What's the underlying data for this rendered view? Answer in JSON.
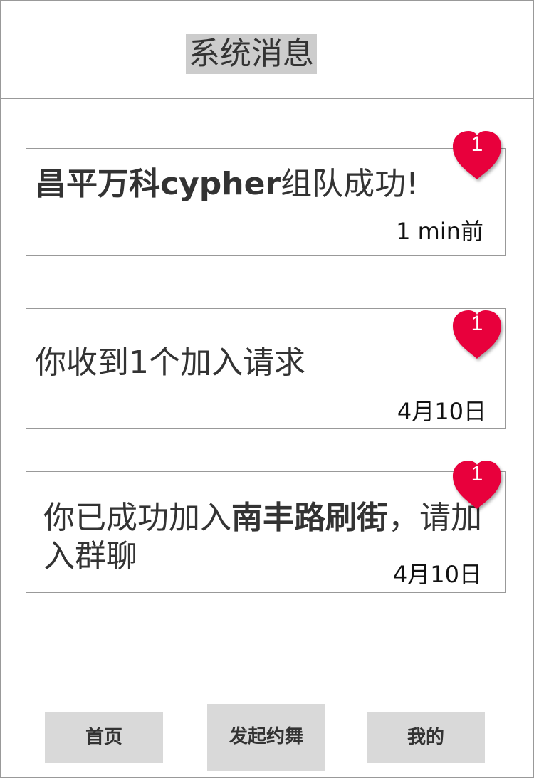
{
  "header": {
    "title": "系统消息"
  },
  "messages": [
    {
      "bold_part": "昌平万科cypher",
      "normal_part": "组队成功!",
      "time": "1 min前",
      "badge": "1"
    },
    {
      "text": "你收到1个加入请求",
      "time": "4月10日",
      "badge": "1"
    },
    {
      "prefix": "你已成功加入",
      "bold_part": "南丰路刷街",
      "suffix": "，请加入群聊",
      "time": "4月10日",
      "badge": "1"
    }
  ],
  "nav": {
    "home": "首页",
    "launch": "发起约舞",
    "mine": "我的"
  },
  "colors": {
    "badge": "#e8003c",
    "nav_button": "#d9d9d9",
    "title_highlight": "#cccccc"
  },
  "icons": {
    "badge_shape": "heart-badge-icon"
  }
}
